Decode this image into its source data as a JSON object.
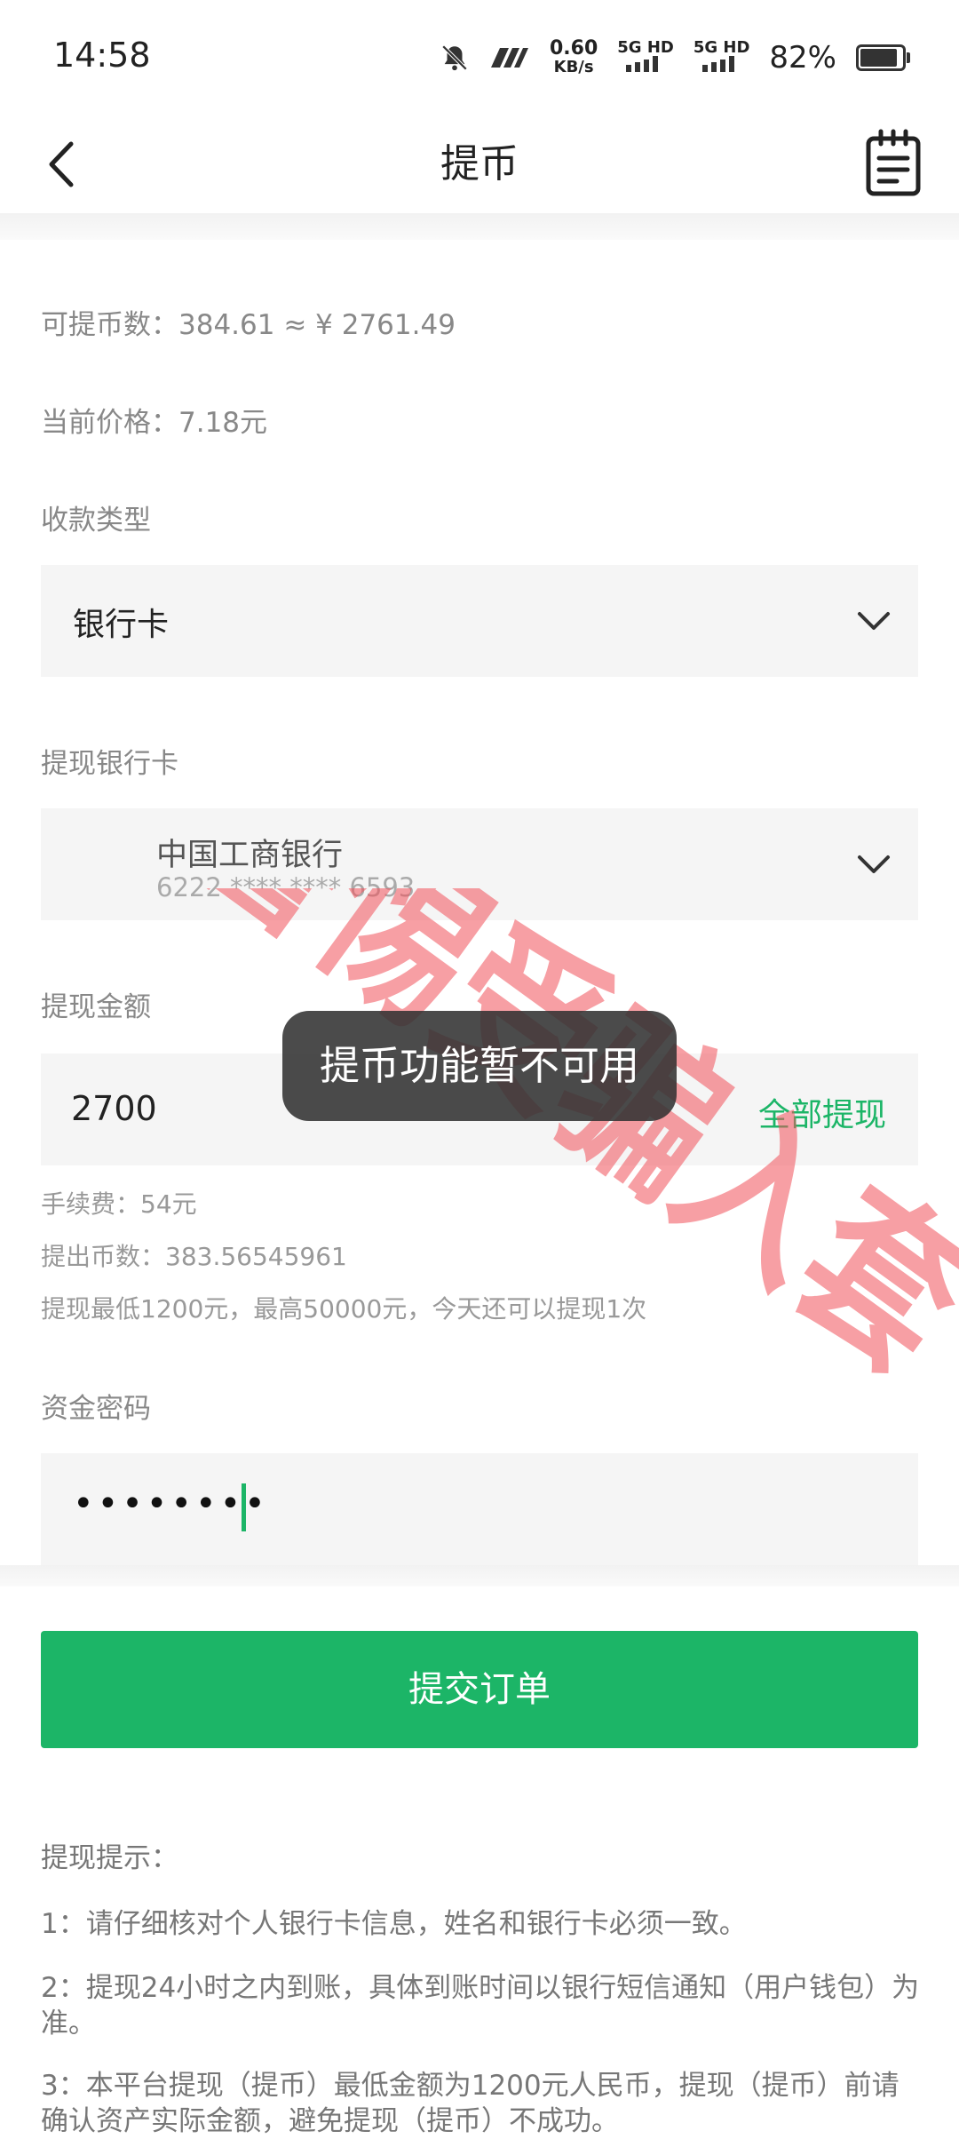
{
  "status_bar": {
    "time": "14:58",
    "net_speed_value": "0.60",
    "net_speed_unit": "KB/s",
    "sim1_label": "5G HD",
    "sim2_label": "5G HD",
    "battery_pct": "82%",
    "battery_level": 0.82,
    "icons": [
      "mute-bell-icon",
      "nfc-icon",
      "signal-icon",
      "battery-icon"
    ]
  },
  "header": {
    "title": "提币",
    "back_icon": "chevron-left-icon",
    "records_icon": "notepad-icon"
  },
  "info": {
    "withdrawable": "可提币数：384.61 ≈ ¥ 2761.49",
    "current_price": "当前价格：7.18元"
  },
  "receive_type": {
    "label": "收款类型",
    "value": "银行卡"
  },
  "bank_card": {
    "label": "提现银行卡",
    "bank_name": "中国工商银行",
    "card_number": "6222 **** **** 6593"
  },
  "amount": {
    "label": "提现金额",
    "value": "2700",
    "all_button": "全部提现",
    "fee": "手续费：54元",
    "coins_out": "提出币数：383.56545961",
    "limits": "提现最低1200元，最高50000元，今天还可以提现1次"
  },
  "password": {
    "label": "资金密码",
    "masked_value": "••••••••"
  },
  "submit_button": "提交订单",
  "tips": {
    "heading": "提现提示：",
    "items": [
      "1：请仔细核对个人银行卡信息，姓名和银行卡必须一致。",
      "2：提现24小时之内到账，具体到账时间以银行短信通知（用户钱包）为准。",
      "3：本平台提现（提币）最低金额为1200元人民币，提现（提币）前请确认资产实际金额，避免提现（提币）不成功。"
    ]
  },
  "toast": "提币功能暂不可用",
  "watermark_text": "警惕受骗入套",
  "colors": {
    "accent_green": "#1cb567",
    "watermark_red": "#f0505a",
    "field_bg": "#f5f5f5"
  }
}
